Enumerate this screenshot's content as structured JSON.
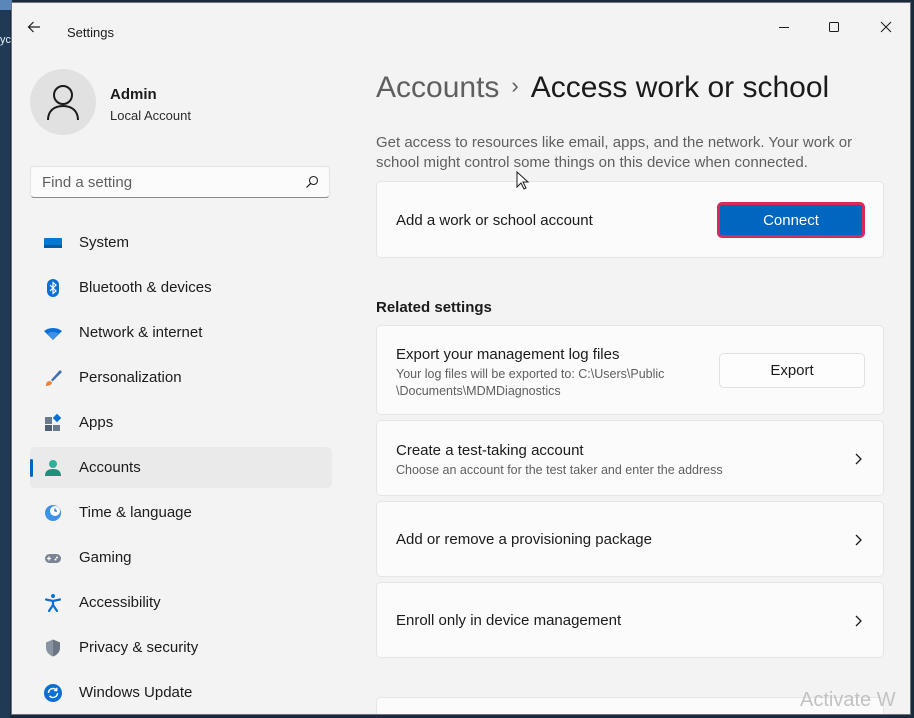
{
  "desktop": {
    "icon_label": "yc"
  },
  "window": {
    "title": "Settings"
  },
  "profile": {
    "name": "Admin",
    "account_type": "Local Account"
  },
  "search": {
    "placeholder": "Find a setting",
    "value": ""
  },
  "nav": {
    "items": [
      {
        "label": "System",
        "icon": "system-icon",
        "active": false
      },
      {
        "label": "Bluetooth & devices",
        "icon": "bluetooth-icon",
        "active": false
      },
      {
        "label": "Network & internet",
        "icon": "wifi-icon",
        "active": false
      },
      {
        "label": "Personalization",
        "icon": "brush-icon",
        "active": false
      },
      {
        "label": "Apps",
        "icon": "apps-icon",
        "active": false
      },
      {
        "label": "Accounts",
        "icon": "person-icon",
        "active": true
      },
      {
        "label": "Time & language",
        "icon": "globe-clock-icon",
        "active": false
      },
      {
        "label": "Gaming",
        "icon": "gamepad-icon",
        "active": false
      },
      {
        "label": "Accessibility",
        "icon": "accessibility-icon",
        "active": false
      },
      {
        "label": "Privacy & security",
        "icon": "shield-icon",
        "active": false
      },
      {
        "label": "Windows Update",
        "icon": "update-icon",
        "active": false
      }
    ]
  },
  "main": {
    "breadcrumb": {
      "parent": "Accounts",
      "separator": "›",
      "current": "Access work or school"
    },
    "description": "Get access to resources like email, apps, and the network. Your work or school might control some things on this device when connected.",
    "add_account": {
      "label": "Add a work or school account",
      "button": "Connect"
    },
    "related_title": "Related settings",
    "export": {
      "title": "Export your management log files",
      "subtitle_line1": "Your log files will be exported to: C:\\Users\\Public",
      "subtitle_line2": "\\Documents\\MDMDiagnostics",
      "button": "Export"
    },
    "test_account": {
      "title": "Create a test-taking account",
      "subtitle": "Choose an account for the test taker and enter the address"
    },
    "provisioning": {
      "title": "Add or remove a provisioning package"
    },
    "enroll": {
      "title": "Enroll only in device management"
    }
  },
  "watermark": "Activate W",
  "colors": {
    "accent": "#0067c0",
    "highlight_border": "#d62a58",
    "window_bg": "#f3f3f3",
    "card_bg": "#fbfbfb"
  }
}
